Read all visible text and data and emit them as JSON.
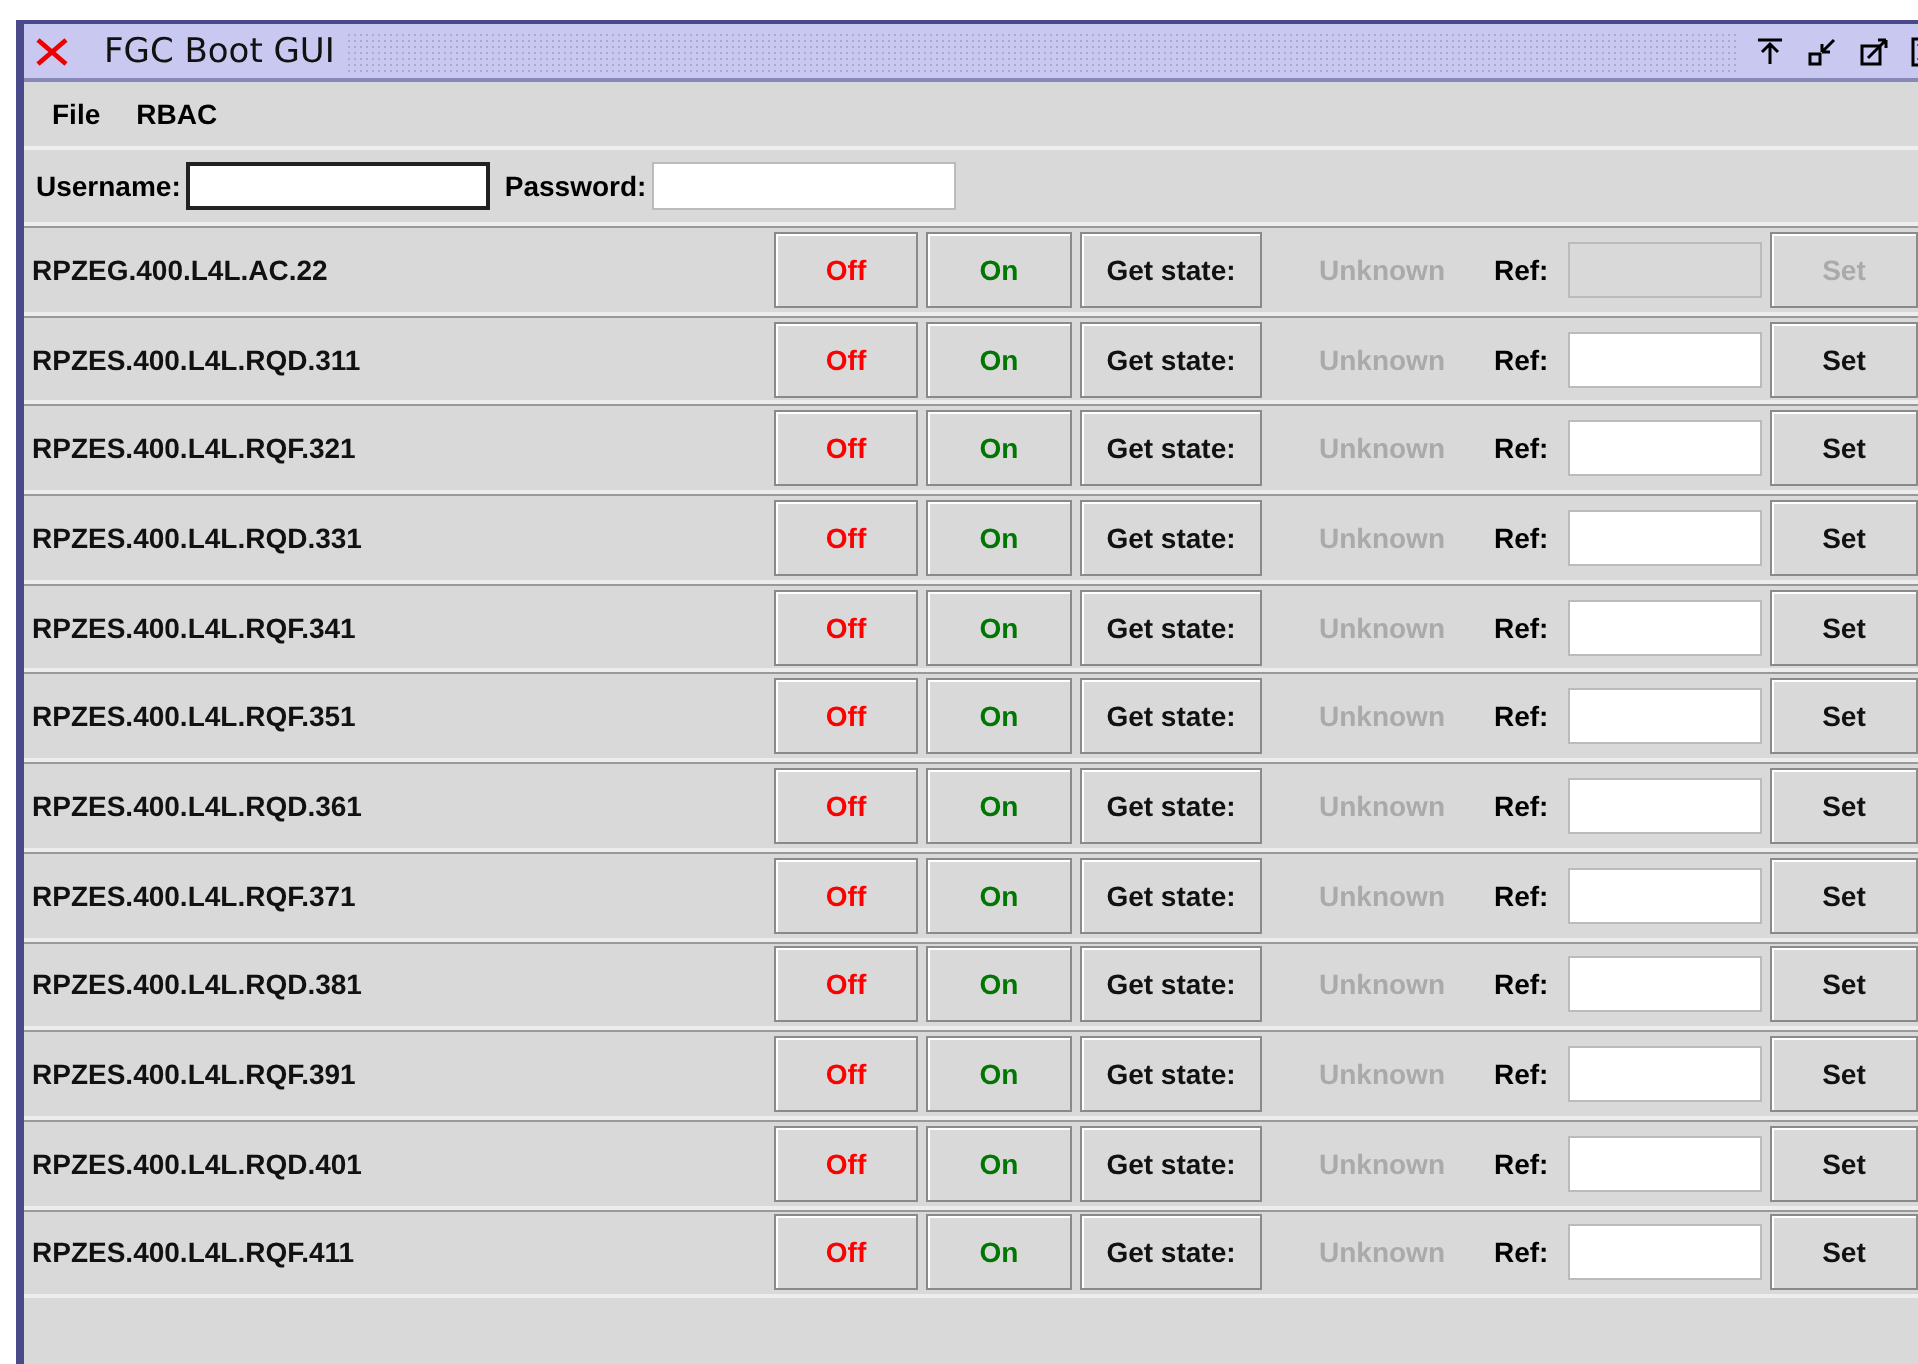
{
  "window": {
    "title": "FGC Boot GUI"
  },
  "menu": [
    {
      "label": "File"
    },
    {
      "label": "RBAC"
    }
  ],
  "login": {
    "username_label": "Username:",
    "username_focused": true,
    "password_label": "Password:"
  },
  "devices": [
    {
      "name": "RPZEG.400.L4L.AC.22",
      "off": "Off",
      "on": "On",
      "get_state": "Get state:",
      "state": "Unknown",
      "ref_label": "Ref:",
      "set": "Set",
      "disabled": true
    },
    {
      "name": "RPZES.400.L4L.RQD.311",
      "off": "Off",
      "on": "On",
      "get_state": "Get state:",
      "state": "Unknown",
      "ref_label": "Ref:",
      "set": "Set",
      "disabled": false
    },
    {
      "name": "RPZES.400.L4L.RQF.321",
      "off": "Off",
      "on": "On",
      "get_state": "Get state:",
      "state": "Unknown",
      "ref_label": "Ref:",
      "set": "Set",
      "disabled": false
    },
    {
      "name": "RPZES.400.L4L.RQD.331",
      "off": "Off",
      "on": "On",
      "get_state": "Get state:",
      "state": "Unknown",
      "ref_label": "Ref:",
      "set": "Set",
      "disabled": false
    },
    {
      "name": "RPZES.400.L4L.RQF.341",
      "off": "Off",
      "on": "On",
      "get_state": "Get state:",
      "state": "Unknown",
      "ref_label": "Ref:",
      "set": "Set",
      "disabled": false
    },
    {
      "name": "RPZES.400.L4L.RQF.351",
      "off": "Off",
      "on": "On",
      "get_state": "Get state:",
      "state": "Unknown",
      "ref_label": "Ref:",
      "set": "Set",
      "disabled": false
    },
    {
      "name": "RPZES.400.L4L.RQD.361",
      "off": "Off",
      "on": "On",
      "get_state": "Get state:",
      "state": "Unknown",
      "ref_label": "Ref:",
      "set": "Set",
      "disabled": false
    },
    {
      "name": "RPZES.400.L4L.RQF.371",
      "off": "Off",
      "on": "On",
      "get_state": "Get state:",
      "state": "Unknown",
      "ref_label": "Ref:",
      "set": "Set",
      "disabled": false
    },
    {
      "name": "RPZES.400.L4L.RQD.381",
      "off": "Off",
      "on": "On",
      "get_state": "Get state:",
      "state": "Unknown",
      "ref_label": "Ref:",
      "set": "Set",
      "disabled": false
    },
    {
      "name": "RPZES.400.L4L.RQF.391",
      "off": "Off",
      "on": "On",
      "get_state": "Get state:",
      "state": "Unknown",
      "ref_label": "Ref:",
      "set": "Set",
      "disabled": false
    },
    {
      "name": "RPZES.400.L4L.RQD.401",
      "off": "Off",
      "on": "On",
      "get_state": "Get state:",
      "state": "Unknown",
      "ref_label": "Ref:",
      "set": "Set",
      "disabled": false
    },
    {
      "name": "RPZES.400.L4L.RQF.411",
      "off": "Off",
      "on": "On",
      "get_state": "Get state:",
      "state": "Unknown",
      "ref_label": "Ref:",
      "set": "Set",
      "disabled": false
    }
  ]
}
